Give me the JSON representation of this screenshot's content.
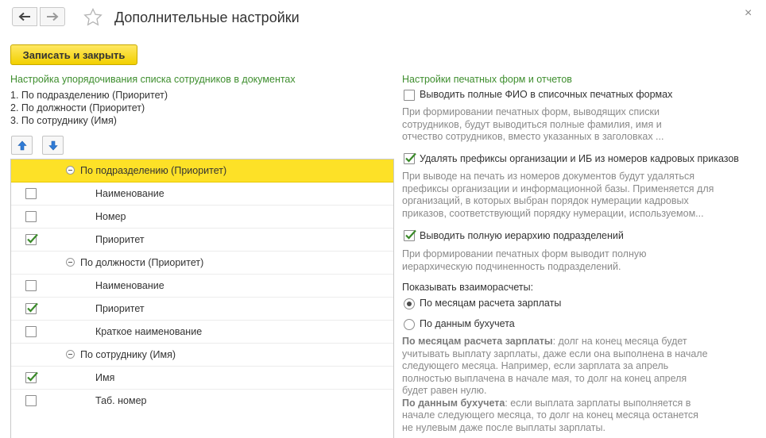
{
  "window": {
    "title": "Дополнительные настройки",
    "close_glyph": "×"
  },
  "toolbar": {
    "save_label": "Записать и закрыть"
  },
  "left": {
    "heading": "Настройка упорядочивания списка сотрудников в документах",
    "order_lines": [
      "1. По подразделению (Приоритет)",
      "2. По должности (Приоритет)",
      "3. По сотруднику (Имя)"
    ],
    "tree": [
      {
        "type": "group",
        "label": "По подразделению (Приоритет)",
        "selected": true
      },
      {
        "type": "item",
        "label": "Наименование",
        "checked": false
      },
      {
        "type": "item",
        "label": "Номер",
        "checked": false
      },
      {
        "type": "item",
        "label": "Приоритет",
        "checked": true
      },
      {
        "type": "group",
        "label": "По должности (Приоритет)",
        "selected": false
      },
      {
        "type": "item",
        "label": "Наименование",
        "checked": false
      },
      {
        "type": "item",
        "label": "Приоритет",
        "checked": true
      },
      {
        "type": "item",
        "label": "Краткое наименование",
        "checked": false
      },
      {
        "type": "group",
        "label": "По сотруднику (Имя)",
        "selected": false
      },
      {
        "type": "item",
        "label": "Имя",
        "checked": true
      },
      {
        "type": "item",
        "label": "Таб. номер",
        "checked": false
      }
    ]
  },
  "right": {
    "heading": "Настройки печатных форм и отчетов",
    "opt1": {
      "label": "Выводить полные ФИО в списочных печатных формах",
      "checked": false,
      "desc": [
        "При формировании печатных форм, выводящих списки",
        "сотрудников, будут выводиться полные фамилия, имя и",
        "отчество сотрудников, вместо указанных в заголовках ..."
      ]
    },
    "opt2": {
      "label": "Удалять префиксы организации и ИБ из номеров кадровых приказов",
      "checked": true,
      "desc": [
        "При выводе на печать из номеров документов будут удаляться",
        "префиксы организации и информационной базы. Применяется для",
        "организаций, в которых выбран порядок нумерации кадровых",
        "приказов, соответствующий порядку нумерации, используемом..."
      ]
    },
    "opt3": {
      "label": "Выводить полную иерархию подразделений",
      "checked": true,
      "desc": [
        "При формировании печатных форм выводит полную",
        "иерархическую подчиненность подразделений."
      ]
    },
    "settlements": {
      "label": "Показывать взаиморасчеты:",
      "radio1": "По месяцам расчета зарплаты",
      "radio2": "По данным бухучета",
      "selected": "radio1"
    },
    "explain": {
      "b1_bold": "По месяцам расчета зарплаты",
      "b1_rest": ": долг на конец месяца будет",
      "b1_lines": [
        "учитывать выплату зарплаты, даже если она выполнена в начале",
        "следующего месяца. Например, если зарплата за апрель",
        "полностью выплачена в начале мая, то долг на конец апреля",
        "будет равен нулю."
      ],
      "b2_bold": "По данным бухучета",
      "b2_rest": ": если выплата зарплаты выполняется в",
      "b2_lines": [
        "начале следующего месяца, то долг на конец месяца останется",
        "не нулевым даже после выплаты зарплаты."
      ]
    }
  },
  "colors": {
    "accent_yellow": "#fde127",
    "heading_green": "#3e8e2e",
    "check_green": "#3b8a2a",
    "arrow_blue": "#2f7bd6"
  },
  "icons": {
    "back": "arrow-left-icon",
    "forward": "arrow-right-icon",
    "favorite": "star-icon",
    "close": "close-icon",
    "move_up": "arrow-up-icon",
    "move_down": "arrow-down-icon"
  }
}
